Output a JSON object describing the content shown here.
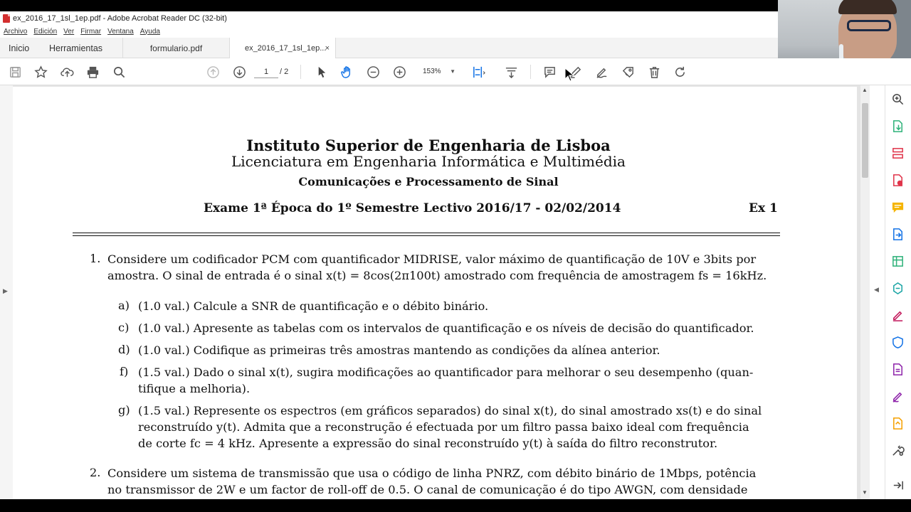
{
  "window": {
    "title": "ex_2016_17_1sl_1ep.pdf - Adobe Acrobat Reader DC (32-bit)"
  },
  "menu": [
    "Archivo",
    "Edición",
    "Ver",
    "Firmar",
    "Ventana",
    "Ayuda"
  ],
  "tabs": {
    "home": "Inicio",
    "tools": "Herramientas",
    "doc1": "formulario.pdf",
    "doc2": "ex_2016_17_1sl_1ep...",
    "close_glyph": "×"
  },
  "toolbar": {
    "current_page": "1",
    "total_pages": "/ 2",
    "zoom": "153%",
    "icons": [
      "save-icon",
      "star-icon",
      "upload-icon",
      "print-icon",
      "search-icon",
      "page-up-icon",
      "page-down-icon",
      "select-arrow-icon",
      "hand-icon",
      "zoom-out-icon",
      "zoom-in-icon",
      "fit-page-icon",
      "scroll-mode-icon",
      "comment-icon",
      "highlight-pen-icon",
      "sign-icon",
      "stamp-icon",
      "trash-icon",
      "rotate-icon"
    ]
  },
  "right_tools": [
    "search-zoom-icon",
    "export-pdf-icon",
    "organize-pages-icon",
    "create-pdf-icon",
    "comment-icon",
    "convert-icon",
    "excel-icon",
    "compress-icon",
    "fill-sign-icon",
    "protect-icon",
    "save-pdf-icon",
    "edit-icon",
    "send-icon",
    "tools-icon",
    "expand-icon"
  ],
  "accent_color": "#c0392b",
  "document": {
    "institution": "Instituto Superior de Engenharia de Lisboa",
    "degree": "Licenciatura em Engenharia Informática e Multimédia",
    "course": "Comunicações e Processamento de Sinal",
    "exam": "Exame 1ª Época do 1º Semestre Lectivo 2016/17  - 02/02/2014",
    "exercise": "Ex 1",
    "q1_num": "1.",
    "q1_line1": "Considere um codificador PCM com quantificador MIDRISE, valor máximo de quantificação de 10V e 3bits por",
    "q1_line2": "amostra.  O sinal de entrada é o sinal x(t) = 8cos(2π100t) amostrado com frequência de amostragem fs = 16kHz.",
    "items": [
      {
        "label": "a)",
        "lines": [
          "(1.0 val.) Calcule a SNR de quantificação e o débito binário."
        ]
      },
      {
        "label": "c)",
        "lines": [
          "(1.0 val.) Apresente as tabelas com os intervalos de quantificação e os níveis de decisão do quantificador."
        ]
      },
      {
        "label": "d)",
        "lines": [
          "(1.0 val.) Codifique as primeiras três amostras mantendo as condições da alínea anterior."
        ]
      },
      {
        "label": "f)",
        "lines": [
          "(1.5 val.) Dado o sinal x(t), sugira modificações ao quantificador para melhorar o seu desempenho (quan-",
          "tifique a melhoria)."
        ]
      },
      {
        "label": "g)",
        "lines": [
          "(1.5 val.) Represente os espectros (em gráficos separados) do sinal x(t), do sinal amostrado xs(t) e do sinal",
          "reconstruído y(t).  Admita que a reconstrução é efectuada por um filtro passa baixo ideal com frequência",
          "de corte fc = 4  kHz.  Apresente a expressão do sinal reconstruído y(t) à saída do filtro reconstrutor."
        ]
      }
    ],
    "q2_num": "2.",
    "q2_line1": "Considere um sistema de transmissão que usa o código de linha PNRZ, com débito binário de 1Mbps, potência",
    "q2_line2": "no transmissor de 2W e um factor de roll-off de 0.5.  O canal de comunicação é do tipo AWGN, com densidade"
  }
}
